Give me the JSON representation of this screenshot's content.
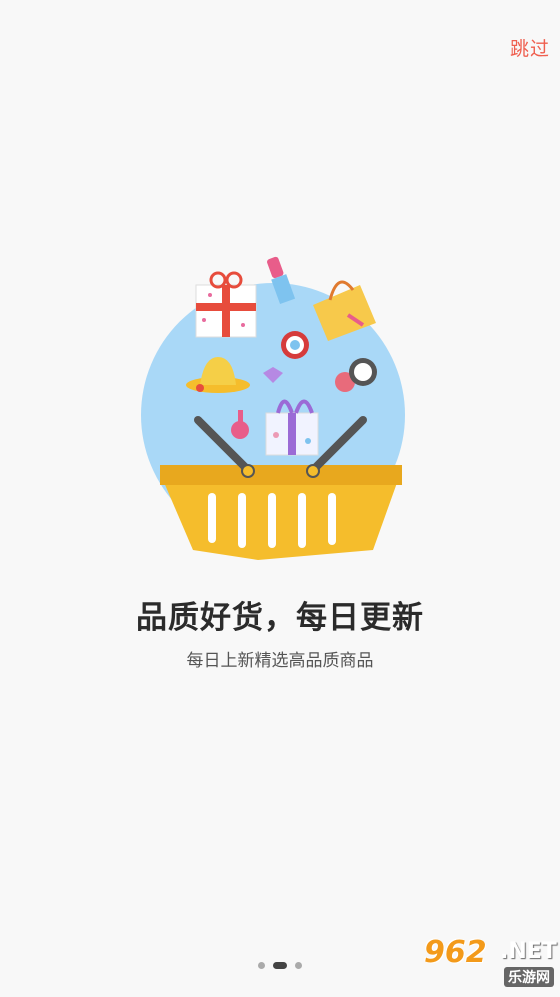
{
  "header": {
    "skip_label": "跳过"
  },
  "content": {
    "title": "品质好货，每日更新",
    "subtitle": "每日上新精选高品质商品"
  },
  "pager": {
    "pages": 3,
    "active_index": 1
  },
  "watermark": {
    "number": "962",
    "suffix": ".NET",
    "text": "乐游网"
  },
  "colors": {
    "accent": "#ef5f4f",
    "circle": "#a9d8f7",
    "basket": "#f5bd2c"
  }
}
